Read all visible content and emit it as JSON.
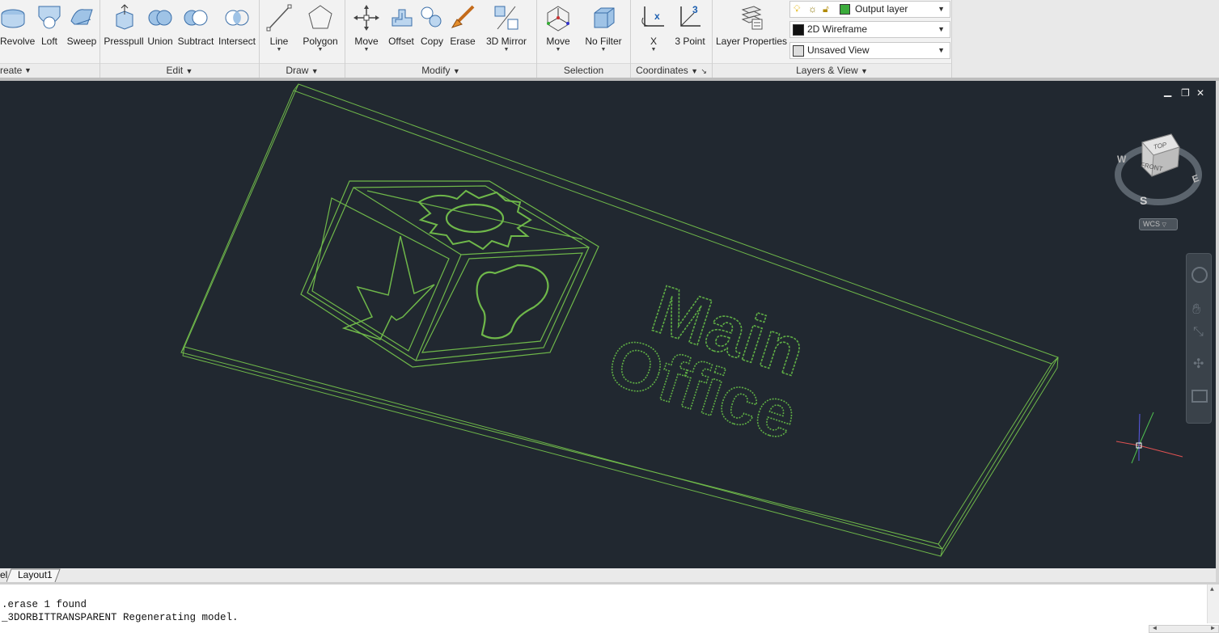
{
  "ribbon": {
    "panels": [
      {
        "title": "reate"
      },
      {
        "title": "Edit"
      },
      {
        "title": "Draw"
      },
      {
        "title": "Modify"
      },
      {
        "title": "Selection"
      },
      {
        "title": "Coordinates"
      },
      {
        "title": "Layers & View"
      }
    ],
    "tools": {
      "revolve": "Revolve",
      "loft": "Loft",
      "sweep": "Sweep",
      "presspull": "Presspull",
      "union": "Union",
      "subtract": "Subtract",
      "intersect": "Intersect",
      "line": "Line",
      "polygon": "Polygon",
      "move": "Move",
      "offset": "Offset",
      "copy": "Copy",
      "erase": "Erase",
      "mirror3d": "3D Mirror",
      "sel_move": "Move",
      "no_filter": "No Filter",
      "x": "X",
      "three_point": "3 Point",
      "layer_properties": "Layer Properties"
    },
    "dropdowns": {
      "layer": "Output layer",
      "visual_style": "2D Wireframe",
      "view": "Unsaved View"
    },
    "colors": {
      "layer_swatch": "#3bab3b"
    }
  },
  "viewport": {
    "win_min": "▁",
    "win_restore": "❐",
    "win_close": "✕",
    "background": "#212830",
    "wire_color": "#6fb84a",
    "text_wire_color": "#5fae45"
  },
  "viewcube": {
    "top": "TOP",
    "front": "FRONT",
    "w": "W",
    "e": "E",
    "s": "S",
    "wcs": "WCS"
  },
  "model": {
    "sign_text_line1": "Main",
    "sign_text_line2": "Office"
  },
  "tabs": {
    "model": "el",
    "layout1": "Layout1"
  },
  "command": {
    "line1": ".erase 1 found",
    "line2": "_3DORBITTRANSPARENT Regenerating model."
  }
}
